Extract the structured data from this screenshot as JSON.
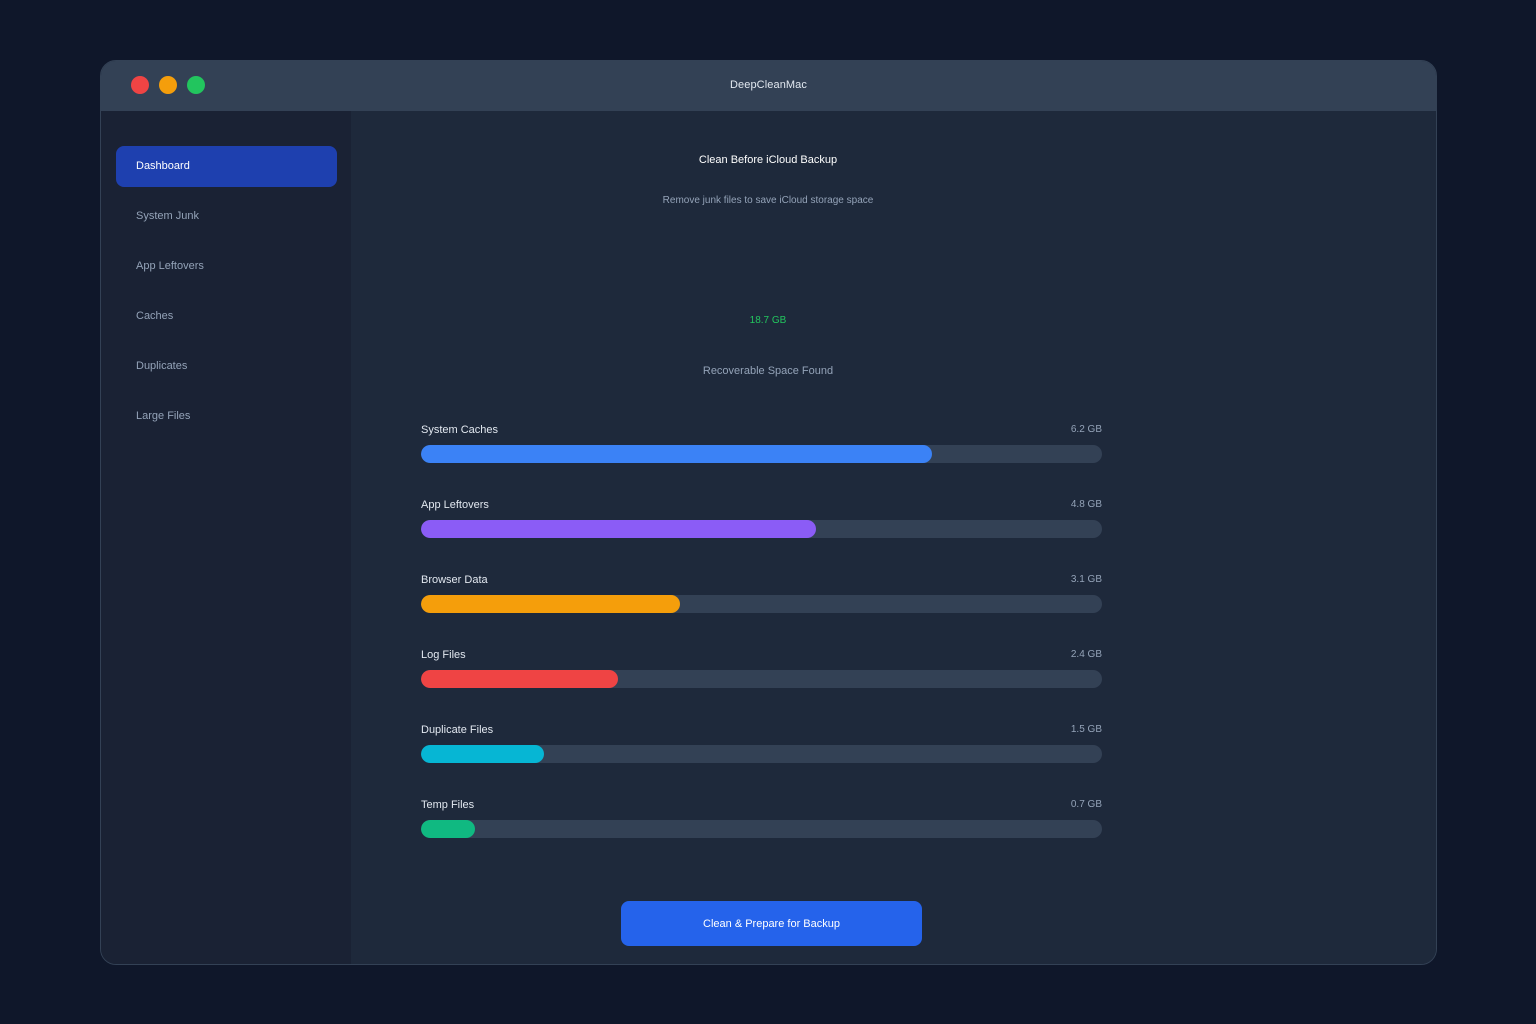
{
  "window": {
    "title": "DeepCleanMac"
  },
  "sidebar": {
    "items": [
      {
        "label": "Dashboard",
        "active": true
      },
      {
        "label": "System Junk",
        "active": false
      },
      {
        "label": "App Leftovers",
        "active": false
      },
      {
        "label": "Caches",
        "active": false
      },
      {
        "label": "Duplicates",
        "active": false
      },
      {
        "label": "Large Files",
        "active": false
      }
    ]
  },
  "main": {
    "title": "Clean Before iCloud Backup",
    "subtitle": "Remove junk files to save iCloud storage space",
    "recoverable_value": "18.7 GB",
    "recoverable_label": "Recoverable Space Found",
    "categories": [
      {
        "name": "System Caches",
        "size": "6.2 GB",
        "fill": 0.75,
        "color": "#3b82f6"
      },
      {
        "name": "App Leftovers",
        "size": "4.8 GB",
        "fill": 0.58,
        "color": "#8b5cf6"
      },
      {
        "name": "Browser Data",
        "size": "3.1 GB",
        "fill": 0.38,
        "color": "#f59e0b"
      },
      {
        "name": "Log Files",
        "size": "2.4 GB",
        "fill": 0.29,
        "color": "#ef4444"
      },
      {
        "name": "Duplicate Files",
        "size": "1.5 GB",
        "fill": 0.18,
        "color": "#06b6d4"
      },
      {
        "name": "Temp Files",
        "size": "0.7 GB",
        "fill": 0.08,
        "color": "#10b981"
      }
    ],
    "action_label": "Clean & Prepare for Backup"
  },
  "colors": {
    "accent": "#2563eb",
    "active_nav": "#1e40af",
    "success": "#22c55e"
  }
}
